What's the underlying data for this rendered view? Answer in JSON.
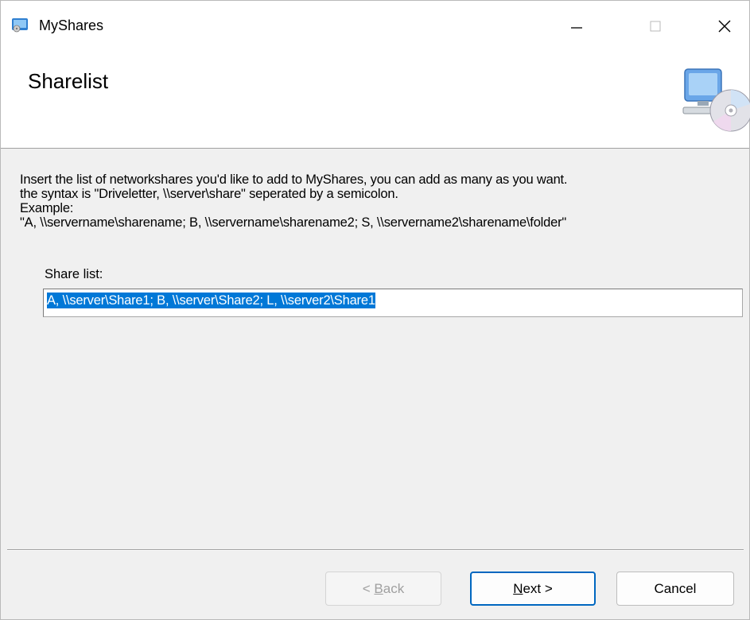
{
  "window": {
    "title": "MyShares",
    "controls": {
      "minimize_glyph": "—",
      "close_glyph": "✕"
    }
  },
  "banner": {
    "title": "Sharelist",
    "icon": "computer-cd-icon"
  },
  "instructions": {
    "line1": "Insert the list of networkshares you'd like to add to MyShares, you can add as many as you want.",
    "line2": "the syntax is \"Driveletter, \\\\server\\share\" seperated by a semicolon.",
    "line3": "Example:",
    "line4": "\"A, \\\\servername\\sharename; B, \\\\servername\\sharename2; S, \\\\servername2\\sharename\\folder\""
  },
  "share_list": {
    "label": "Share list:",
    "value": "A, \\\\server\\Share1; B, \\\\server\\Share2; L, \\\\server2\\Share1"
  },
  "buttons": {
    "back_prefix": "< ",
    "back_key": "B",
    "back_rest": "ack",
    "next_key": "N",
    "next_rest": "ext >",
    "cancel": "Cancel"
  },
  "colors": {
    "selection": "#0078d7",
    "default_button_border": "#0067c0"
  }
}
